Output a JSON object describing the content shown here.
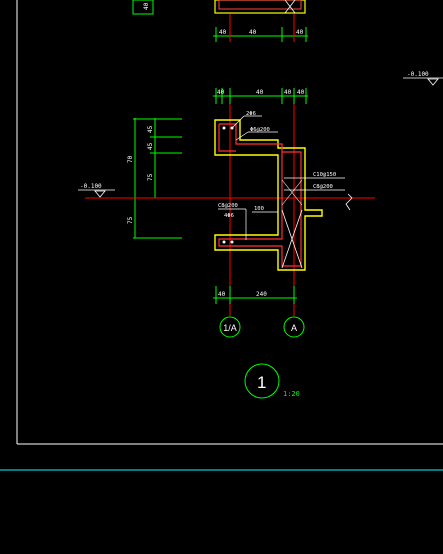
{
  "colors": {
    "background": "#000000",
    "frame": "#ffffff",
    "dimension": "#00ff00",
    "axis_line": "#ff0000",
    "concrete_outline": "#ffff00",
    "rebar": "#ff0000",
    "cyan_rule": "#00aaaa"
  },
  "top_detail": {
    "dims_row_1": [
      "40",
      "40"
    ],
    "dims_row_2": [
      "40",
      "40",
      "40"
    ]
  },
  "upper_detail": {
    "dims_top": [
      "40",
      "40",
      "40",
      "40"
    ],
    "dims_left": [
      "45",
      "45",
      "75",
      "70",
      "75"
    ],
    "labels": {
      "top_bars": "2Φ6",
      "stirrups": "Φ6@200",
      "wall_bar_1": "C10@150",
      "wall_bar_2": "C8@200",
      "slab_bar_1": "C8@200",
      "slab_bar_2": "4Φ6",
      "slab_thk": "100"
    },
    "dims_bottom": [
      "40",
      "240"
    ]
  },
  "levels": {
    "left": "-0.100",
    "right": "-0.100"
  },
  "axes": {
    "left": "1/A",
    "right": "A"
  },
  "title": {
    "number": "1",
    "scale": "1:20"
  }
}
